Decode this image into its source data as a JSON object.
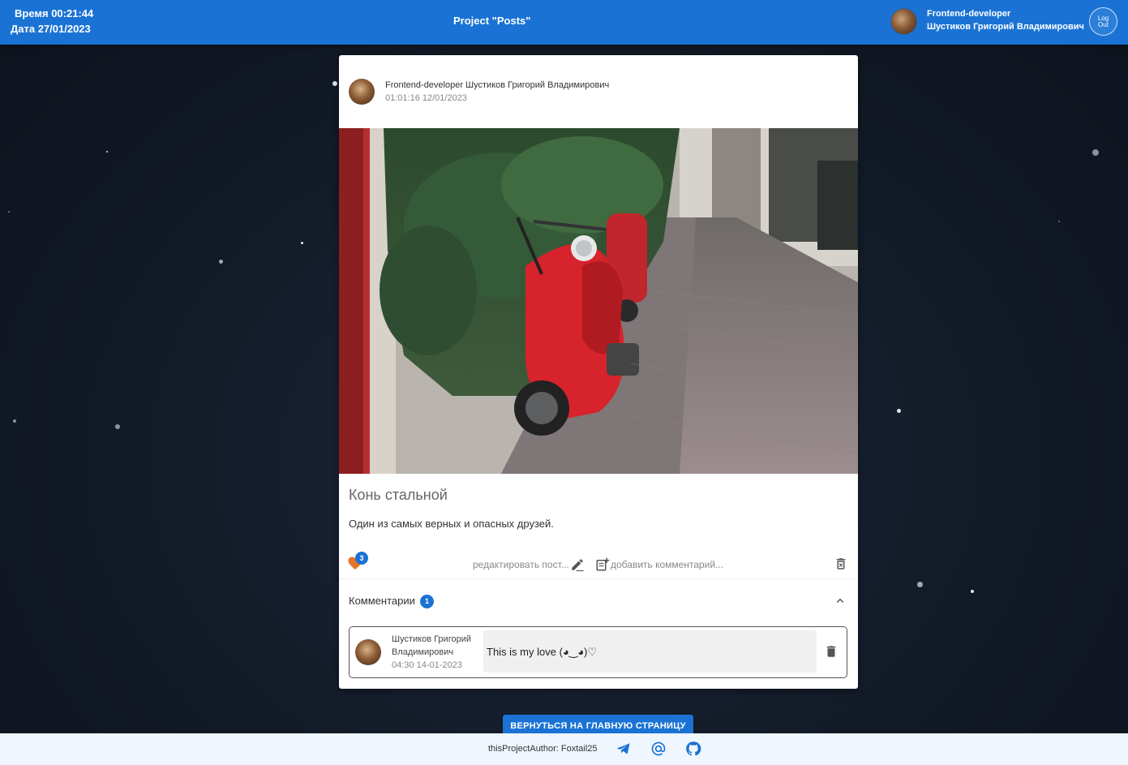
{
  "header": {
    "time_label": "Время 00:21:44",
    "date_label": "Дата 27/01/2023",
    "project_title": "Project \"Posts\"",
    "user_role": "Frontend-developer",
    "user_name": "Шустиков Григорий Владимирович",
    "logout_line1": "Log",
    "logout_line2": "Out"
  },
  "post": {
    "author": "Frontend-developer Шустиков Григорий Владимирович",
    "date": "01:01:16 12/01/2023",
    "title": "Конь стальной",
    "text": "Один из самых верных и опасных друзей.",
    "likes": "3",
    "edit_label": "редактировать пост...",
    "add_comment_label": "добавить комментарий...",
    "image_icon": "red-scooter-photo"
  },
  "comments": {
    "label": "Комментарии",
    "count": "1",
    "items": [
      {
        "name_line1": "Шустиков Григорий",
        "name_line2": "Владимирович",
        "date": "04:30 14-01-2023",
        "text": "This is my love (◕‿◕)♡"
      }
    ]
  },
  "back_button": "ВЕРНУТЬСЯ НА ГЛАВНУЮ СТРАНИЦУ",
  "footer": {
    "author": "thisProjectAuthor: Foxtail25",
    "icons": [
      "telegram-icon",
      "email-at-icon",
      "github-icon"
    ]
  },
  "colors": {
    "accent": "#1a73d4",
    "like": "#e8742a",
    "background": "#121a27"
  }
}
